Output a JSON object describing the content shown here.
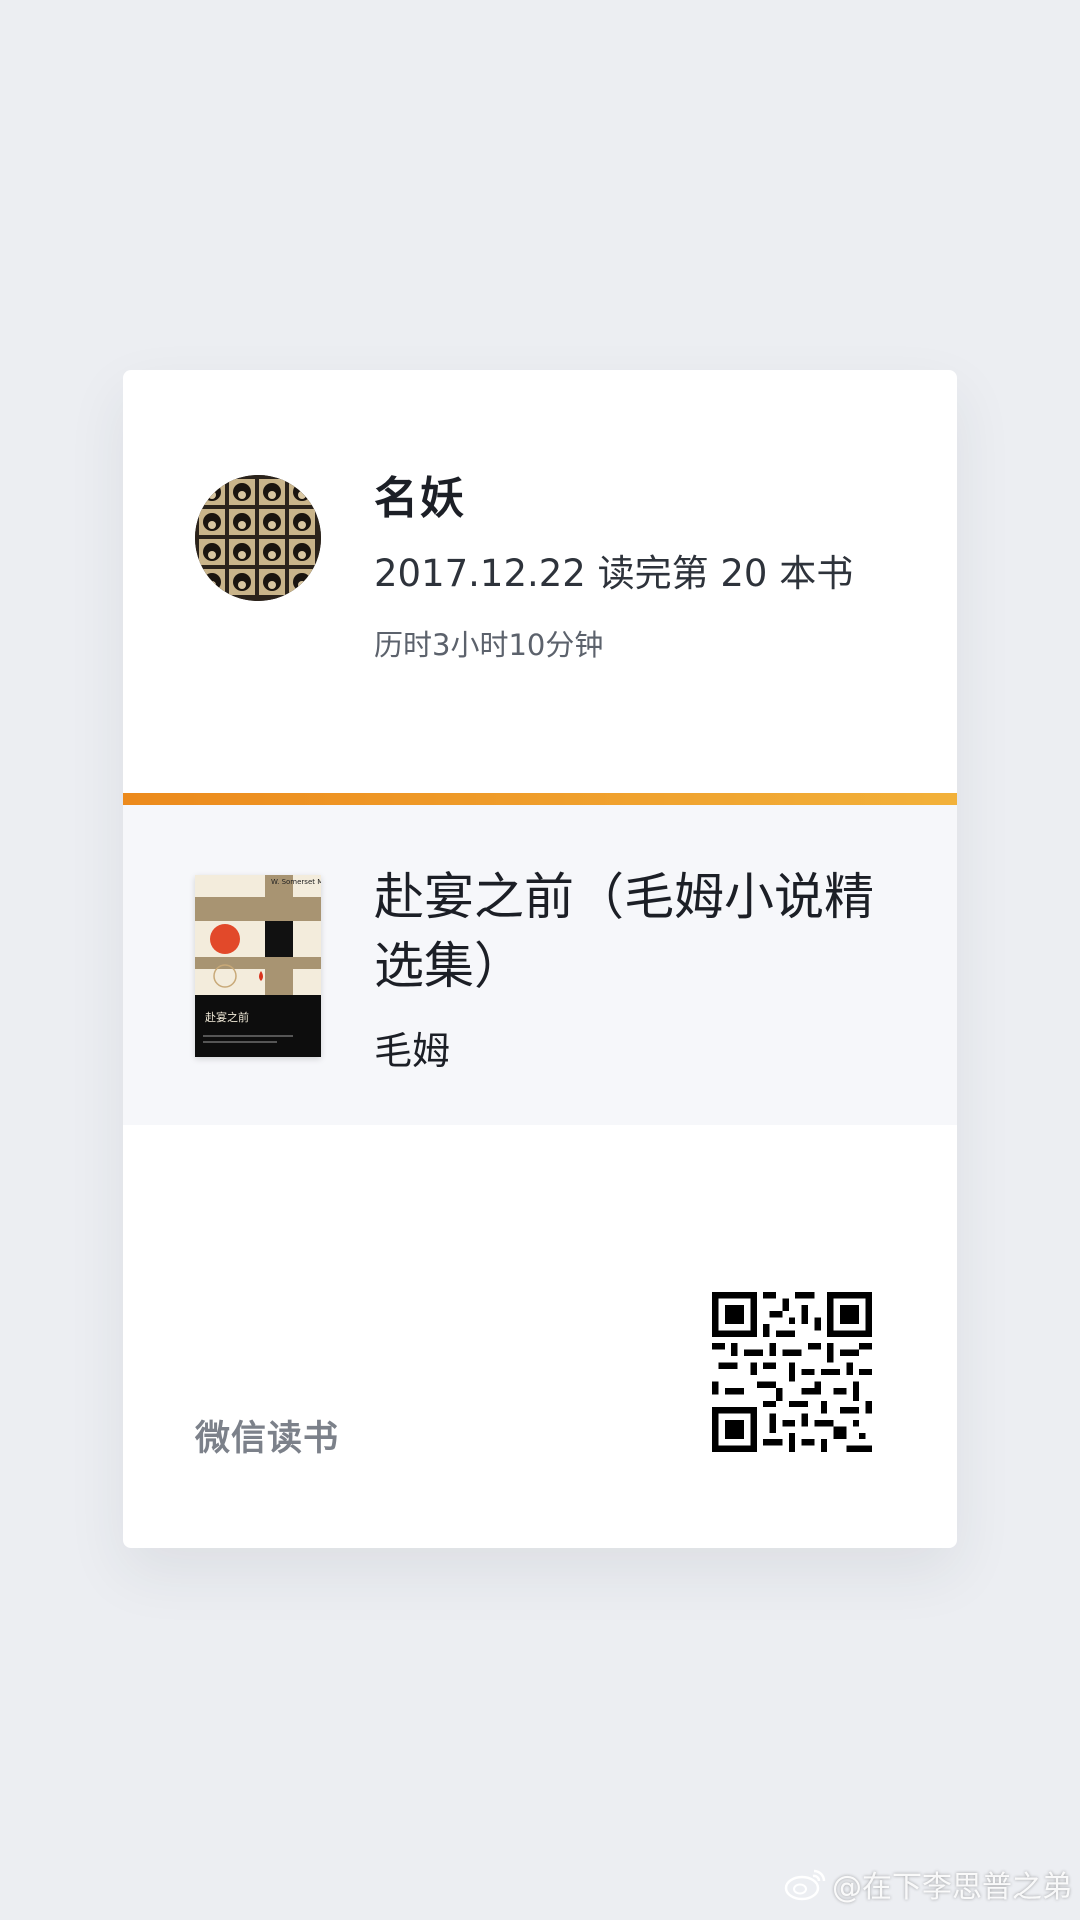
{
  "user": {
    "name": "名妖",
    "read_line": "2017.12.22 读完第 20 本书",
    "duration": "历时3小时10分钟"
  },
  "book": {
    "title": "赴宴之前（毛姆小说精选集）",
    "author": "毛姆",
    "cover_text": {
      "author_en": "W. Somerset Maugham",
      "side_text": "Selected Novels",
      "title_cn": "赴宴之前"
    }
  },
  "footer": {
    "app_name": "微信读书"
  },
  "watermark": {
    "text": "@在下李思普之弟"
  },
  "colors": {
    "background": "#eceef2",
    "card": "#ffffff",
    "accent_start": "#ec8a1c",
    "accent_end": "#f2b13a",
    "book_section": "#f6f7fa"
  },
  "icons": {
    "avatar": "avatar-photo",
    "qr": "qr-code-icon",
    "watermark": "weibo-icon"
  }
}
